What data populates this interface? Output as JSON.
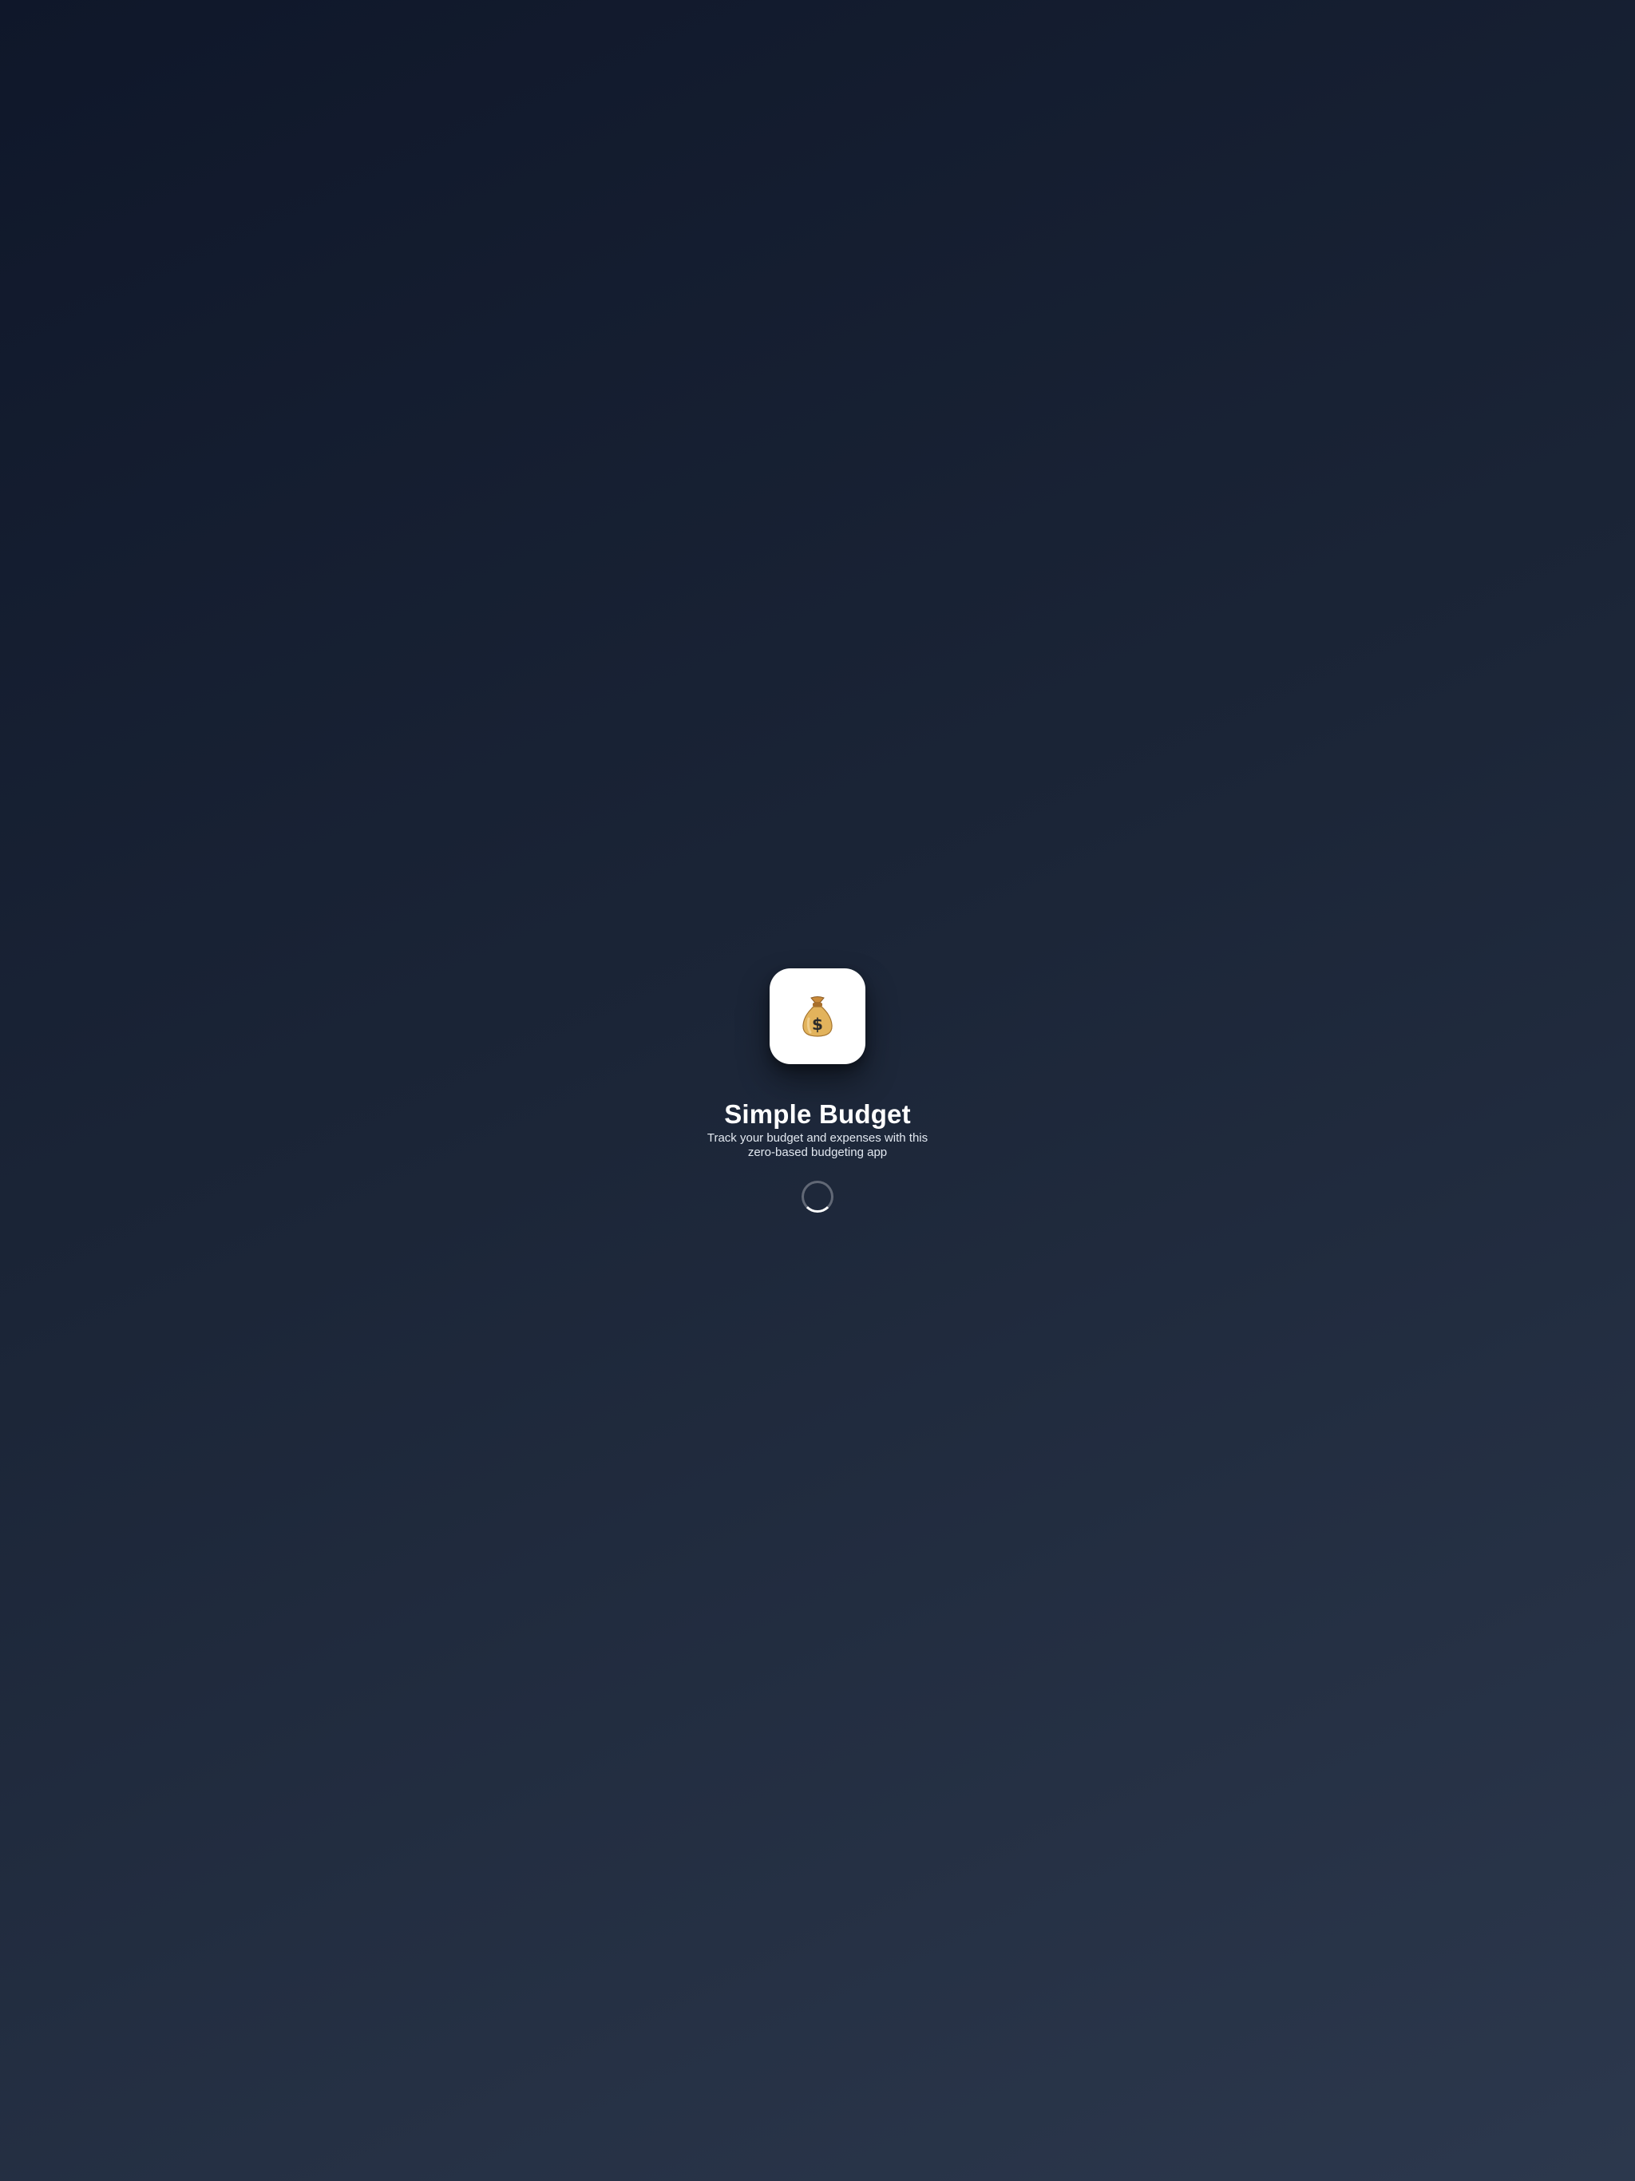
{
  "app": {
    "icon": "money-bag-icon",
    "title": "Simple Budget",
    "tagline": "Track your budget and expenses with this zero-based budgeting app"
  },
  "status": {
    "loading": true,
    "indicator": "spinner-icon"
  },
  "colors": {
    "background_top": "#0f172a",
    "background_bottom": "#2c384d",
    "tile": "#ffffff",
    "text": "#ffffff",
    "subtext": "#e2e8f0"
  }
}
